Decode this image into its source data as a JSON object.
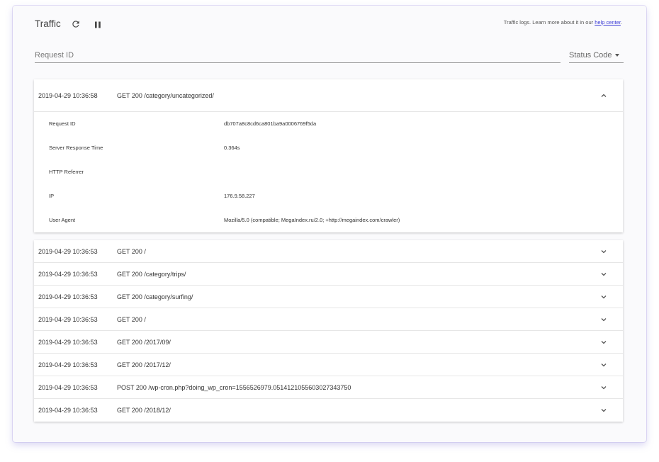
{
  "header": {
    "title": "Traffic",
    "help_text": "Traffic logs. Learn more about it in our ",
    "help_link": "help center",
    "help_suffix": "."
  },
  "filters": {
    "request_placeholder": "Request ID",
    "status_label": "Status Code"
  },
  "expanded_entry": {
    "timestamp": "2019-04-29 10:36:58",
    "request": "GET 200 /category/uncategorized/",
    "details": [
      {
        "key": "Request ID",
        "value": "db707a8c8cd6ca801ba9a0006769f5da"
      },
      {
        "key": "Server Response Time",
        "value": "0.364s"
      },
      {
        "key": "HTTP Referrer",
        "value": ""
      },
      {
        "key": "IP",
        "value": "176.9.58.227"
      },
      {
        "key": "User Agent",
        "value": "Mozilla/5.0 (compatible; MegaIndex.ru/2.0; +http://megaindex.com/crawler)"
      }
    ]
  },
  "entries": [
    {
      "timestamp": "2019-04-29 10:36:53",
      "request": "GET 200 /"
    },
    {
      "timestamp": "2019-04-29 10:36:53",
      "request": "GET 200 /category/trips/"
    },
    {
      "timestamp": "2019-04-29 10:36:53",
      "request": "GET 200 /category/surfing/"
    },
    {
      "timestamp": "2019-04-29 10:36:53",
      "request": "GET 200 /"
    },
    {
      "timestamp": "2019-04-29 10:36:53",
      "request": "GET 200 /2017/09/"
    },
    {
      "timestamp": "2019-04-29 10:36:53",
      "request": "GET 200 /2017/12/"
    },
    {
      "timestamp": "2019-04-29 10:36:53",
      "request": "POST 200 /wp-cron.php?doing_wp_cron=1556526979.0514121055603027343750"
    },
    {
      "timestamp": "2019-04-29 10:36:53",
      "request": "GET 200 /2018/12/"
    }
  ],
  "icons": {
    "refresh": "refresh-icon",
    "pause": "pause-icon",
    "collapse": "chevron-up-icon",
    "expand": "chevron-down-icon"
  },
  "colors": {
    "link": "#3b3bd6",
    "card_shadow": "#b4aae6"
  }
}
